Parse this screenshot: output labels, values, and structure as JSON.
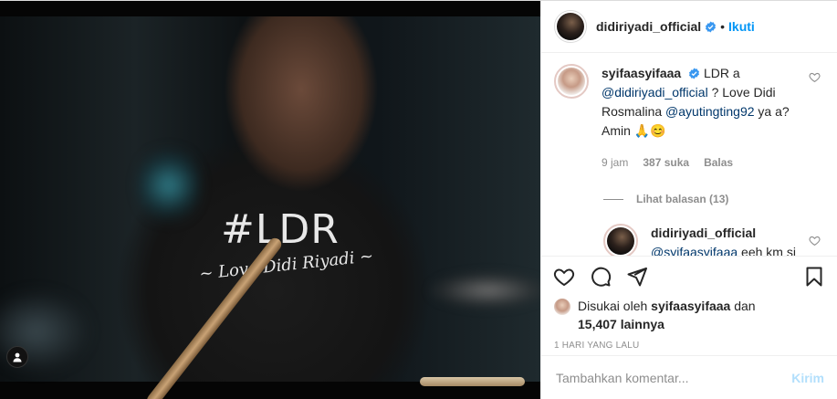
{
  "post": {
    "username": "didiriyadi_official",
    "separator": "•",
    "follow_label": "Ikuti",
    "shirt_text": "#LDR",
    "shirt_subtext": "~ Love Didi Riyadi ~"
  },
  "comments": [
    {
      "username": "syifaasyifaaa",
      "text_parts": [
        "LDR a ",
        "@didiriyadi_official",
        " ? Love Didi Rosmalina ",
        "@ayutingting92",
        " ya a? Amin 🙏😊"
      ],
      "time": "9 jam",
      "likes": "387 suka",
      "reply_label": "Balas",
      "view_replies": "Lihat balasan (13)"
    }
  ],
  "reply": {
    "username": "didiriyadi_official",
    "mention": "@syifaasyifaaa",
    "text": " eeh km si sblitz ini 😊 Amin 😊"
  },
  "likes": {
    "prefix": "Disukai oleh ",
    "user": "syifaasyifaaa",
    "middle": " dan",
    "count": "15,407 lainnya"
  },
  "timestamp": "1 HARI YANG LALU",
  "add_comment": {
    "placeholder": "Tambahkan komentar...",
    "post_label": "Kirim"
  },
  "icons": {
    "verified": "verified-badge-icon",
    "heart": "heart-icon",
    "comment": "comment-icon",
    "share": "share-icon",
    "save": "bookmark-icon",
    "user_tag": "user-tag-icon"
  },
  "colors": {
    "link": "#0095f6",
    "mention": "#00376b",
    "muted": "#8e8e8e",
    "post_disabled": "#b2dffc"
  }
}
